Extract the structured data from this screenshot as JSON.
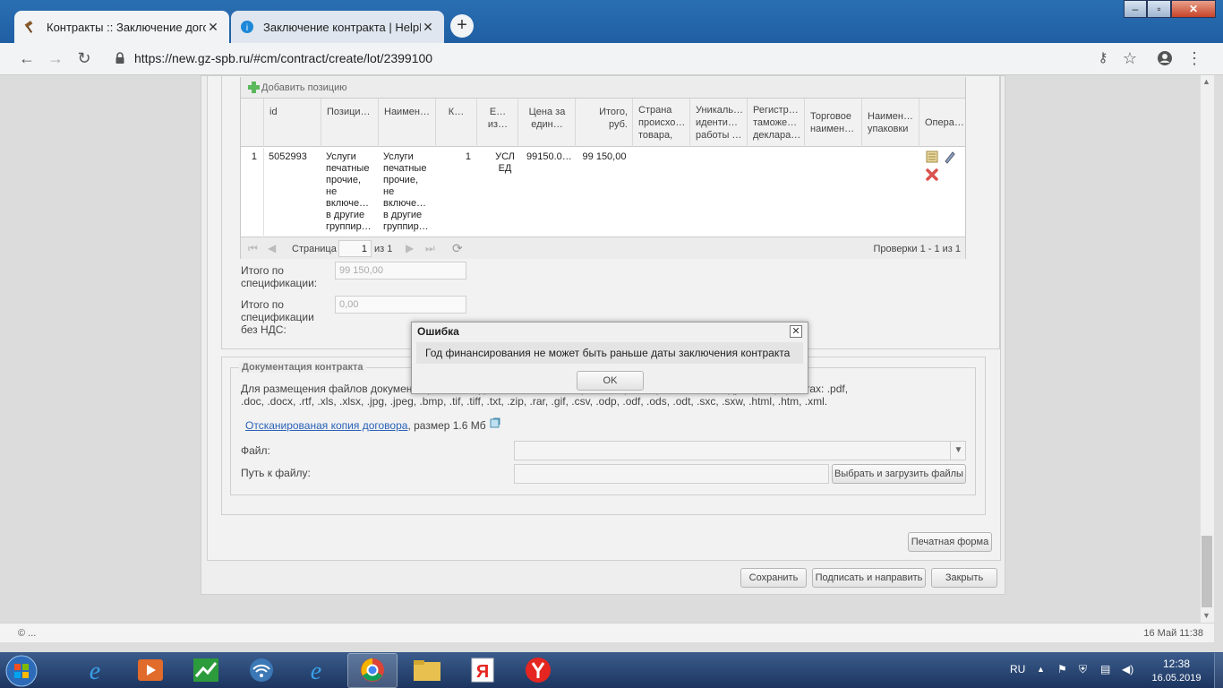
{
  "browser": {
    "tabs": [
      {
        "title": "Контракты :: Заключение договора",
        "active": true
      },
      {
        "title": "Заключение контракта | HelpDesk",
        "active": false
      }
    ],
    "url": "https://new.gz-spb.ru/#cm/contract/create/lot/2399100"
  },
  "grid": {
    "add_label": "Добавить позицию",
    "headers": [
      "id",
      "Позици…",
      "Наимен…",
      "К…",
      "Е… из…",
      "Цена за един…",
      "Итого, руб.",
      "Страна происхо… товара, …",
      "Уникаль… иденти… работы …",
      "Регистр… таможе… деклара…",
      "Торговое наимен…",
      "Наимен… упаковки",
      "Опера…"
    ],
    "rows": [
      {
        "num": "1",
        "id": "5052993",
        "position": "Услуги печатные прочие, не включе… в другие группир…",
        "name": "Услуги печатные прочие, не включе… в другие группир…",
        "qty": "1",
        "unit": "УСЛ ЕД",
        "price": "99150.0…",
        "total": "99 150,00"
      }
    ],
    "pager": {
      "page_label": "Страница",
      "page_value": "1",
      "of_label": "из 1",
      "summary": "Проверки 1 - 1 из 1"
    }
  },
  "totals": {
    "total_label": "Итого по спецификации:",
    "total_value": "99 150,00",
    "novat_label": "Итого по спецификации без НДС:",
    "novat_value": "0,00"
  },
  "docs": {
    "legend": "Документация контракта",
    "text_line1": "Для размещения файлов документации необходимо использовать файлы с расширениями в следующих форматах: .pdf,",
    "text_line2": ".doc, .docx, .rtf, .xls, .xlsx, .jpg, .jpeg, .bmp, .tif, .tiff, .txt, .zip, .rar, .gif, .csv, .odp, .odf, .ods, .odt, .sxc, .sxw, .html, .htm, .xml.",
    "file_link": "Отсканированая копия договора",
    "file_size": ", размер 1.6 Мб",
    "file_label": "Файл:",
    "path_label": "Путь к файлу:",
    "upload_button": "Выбрать и загрузить файлы"
  },
  "buttons": {
    "print": "Печатная форма",
    "save": "Сохранить",
    "sign_send": "Подписать и направить",
    "close": "Закрыть"
  },
  "modal": {
    "title": "Ошибка",
    "message": "Год финансирования не может быть раньше даты заключения контракта",
    "ok": "OK"
  },
  "statusbar": {
    "left": "© ...",
    "right": "16 Май 11:38"
  },
  "taskbar": {
    "lang": "RU",
    "time": "12:38",
    "date": "16.05.2019"
  }
}
